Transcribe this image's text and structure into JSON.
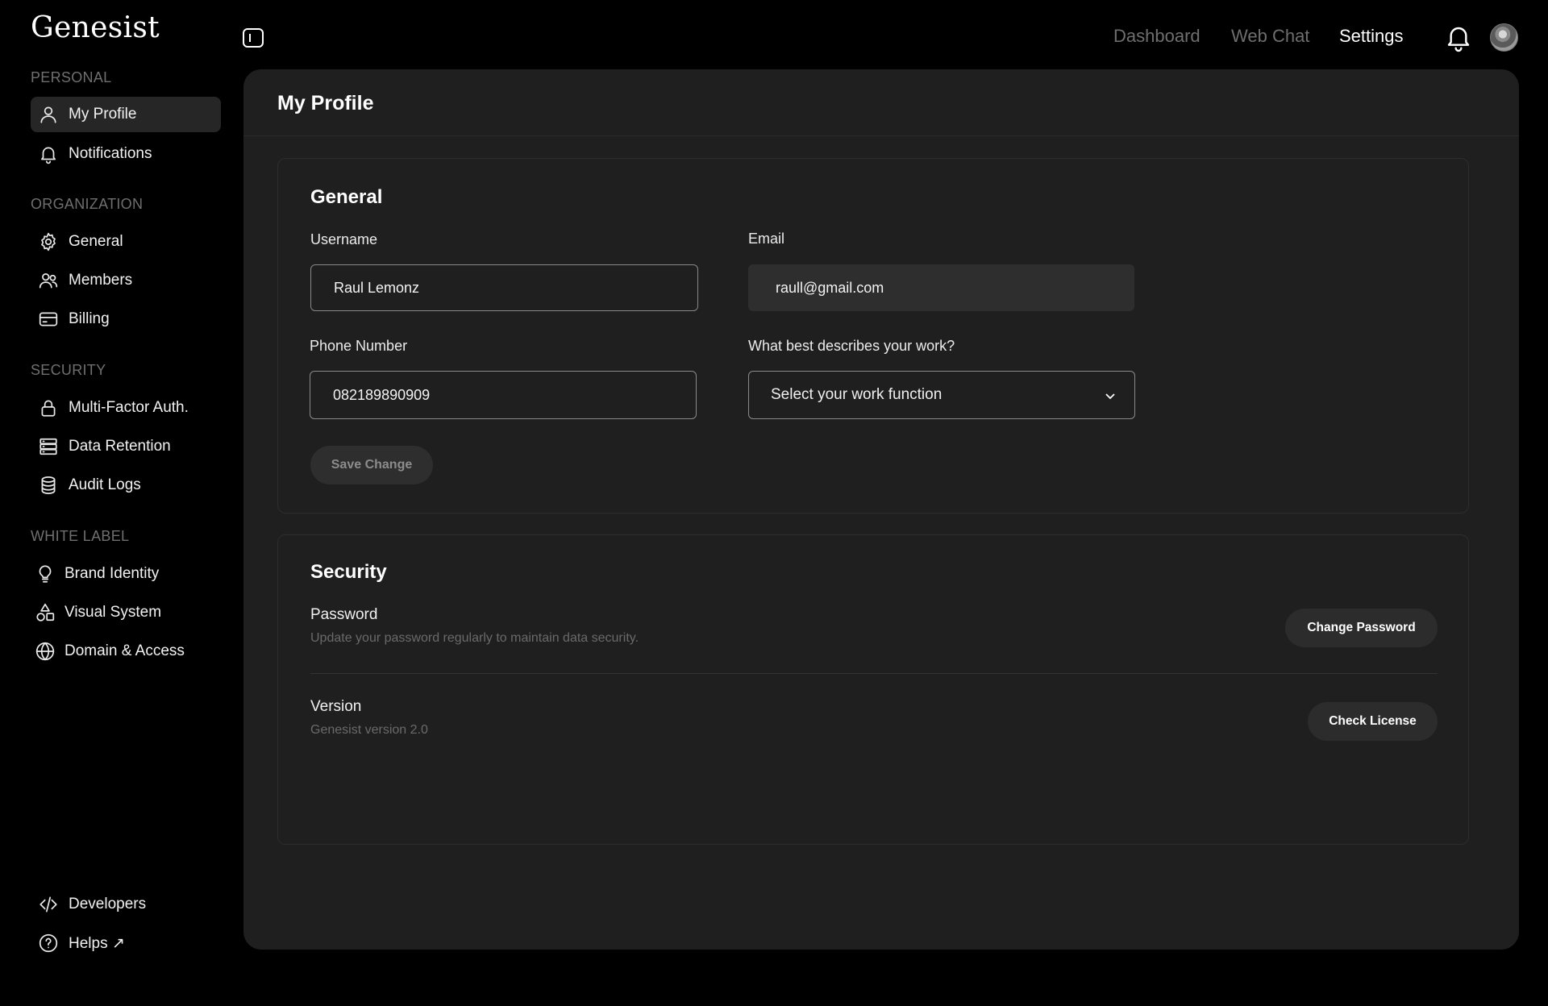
{
  "app": {
    "logo": "Genesist"
  },
  "sidebar": {
    "sections": [
      {
        "title": "PERSONAL"
      },
      {
        "title": "ORGANIZATION"
      },
      {
        "title": "SECURITY"
      },
      {
        "title": "WHITE LABEL"
      }
    ],
    "items": [
      {
        "label": "My Profile",
        "icon": "user-icon"
      },
      {
        "label": "Notifications",
        "icon": "bell-icon"
      },
      {
        "label": "General",
        "icon": "gear-icon"
      },
      {
        "label": "Members",
        "icon": "users-icon"
      },
      {
        "label": "Billing",
        "icon": "credit-card-icon"
      },
      {
        "label": "Multi-Factor Auth.",
        "icon": "lock-icon"
      },
      {
        "label": "Data Retention",
        "icon": "server-icon"
      },
      {
        "label": "Audit Logs",
        "icon": "database-icon"
      },
      {
        "label": "Brand Identity",
        "icon": "lightbulb-icon"
      },
      {
        "label": "Visual System",
        "icon": "shapes-icon"
      },
      {
        "label": "Domain & Access",
        "icon": "globe-icon"
      }
    ],
    "footer": [
      {
        "label": "Developers",
        "icon": "code-icon"
      },
      {
        "label": "Helps ↗",
        "icon": "help-circle-icon"
      }
    ]
  },
  "topnav": {
    "links": [
      {
        "label": "Dashboard"
      },
      {
        "label": "Web Chat"
      },
      {
        "label": "Settings"
      }
    ],
    "active": "Settings"
  },
  "main": {
    "title": "My Profile",
    "general": {
      "title": "General",
      "username_label": "Username",
      "username_value": "Raul Lemonz",
      "email_label": "Email",
      "email_value": "raull@gmail.com",
      "phone_label": "Phone Number",
      "phone_value": "082189890909",
      "work_label": "What best describes your work?",
      "work_placeholder": "Select your work function",
      "save_label": "Save Change"
    },
    "security": {
      "title": "Security",
      "password_label": "Password",
      "password_desc": "Update your password regularly to maintain data security.",
      "change_password_label": "Change Password",
      "version_label": "Version",
      "version_desc": "Genesist version 2.0",
      "check_license_label": "Check License"
    }
  }
}
